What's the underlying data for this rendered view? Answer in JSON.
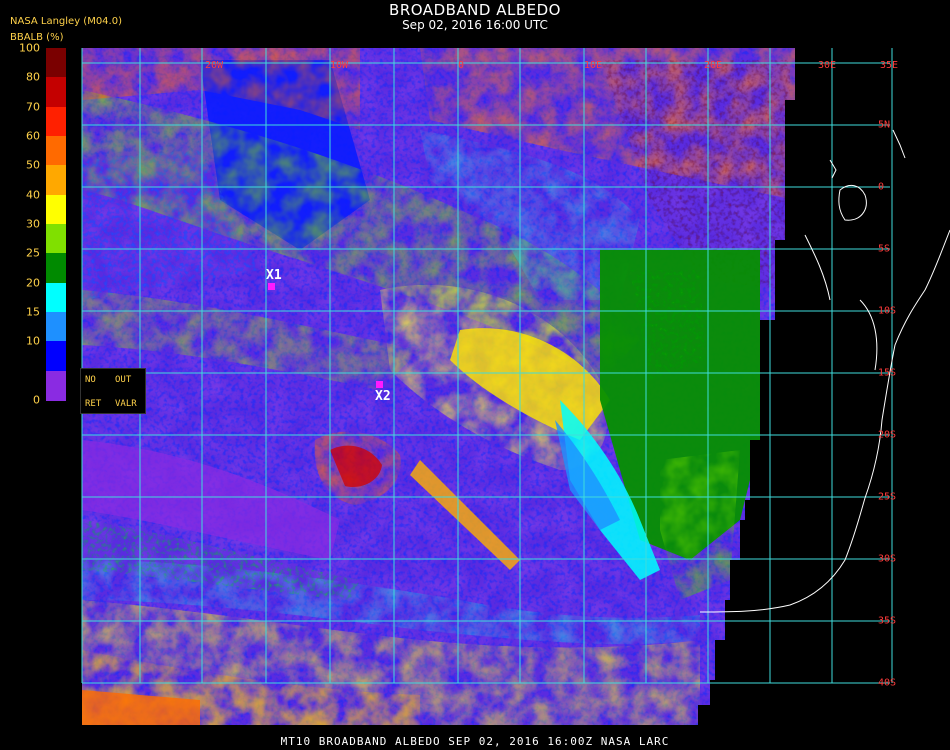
{
  "header": {
    "title": "BROADBAND ALBEDO",
    "subtitle": "Sep 02, 2016 16:00 UTC",
    "credit": "NASA Langley (M04.0)",
    "units_label": "BBALB (%)"
  },
  "colorbar": {
    "tick_labels": [
      "100",
      "80",
      "70",
      "60",
      "50",
      "40",
      "30",
      "25",
      "20",
      "15",
      "10",
      "0"
    ],
    "colors": [
      "#7a0000",
      "#c40000",
      "#ff2000",
      "#ff6a00",
      "#ffa800",
      "#ffff00",
      "#80e000",
      "#008a00",
      "#00ffff",
      "#1e90ff",
      "#0000ff",
      "#8a2be2"
    ]
  },
  "legend": {
    "no": "NO",
    "out": "OUT",
    "ret": "RET",
    "valr": "VALR"
  },
  "map": {
    "lat_labels": [
      "5N",
      "0",
      "5S",
      "10S",
      "15S",
      "20S",
      "25S",
      "30S",
      "35S",
      "40S"
    ],
    "lon_labels": [
      "20W",
      "10W",
      "0",
      "10E",
      "20E",
      "30E",
      "35E"
    ],
    "markers": [
      {
        "label": "X1",
        "color": "#ff1aff"
      },
      {
        "label": "X2",
        "color": "#ff1aff"
      }
    ],
    "grid_color": "#3fdcdc",
    "coast_color": "#ffffff"
  },
  "footer": {
    "text": "MT10  BROADBAND ALBEDO   SEP 02, 2016 16:00Z   NASA LARC"
  }
}
